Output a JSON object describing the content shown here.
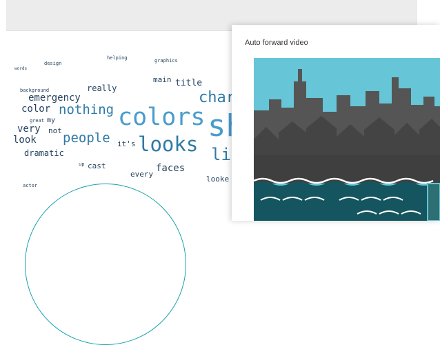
{
  "word_cloud": {
    "words": [
      {
        "text": "helping",
        "cls": "dk"
      },
      {
        "text": "design",
        "cls": "dk"
      },
      {
        "text": "graphics",
        "cls": "dk"
      },
      {
        "text": "words",
        "cls": "dk"
      },
      {
        "text": "main",
        "cls": "dk"
      },
      {
        "text": "title",
        "cls": "dk"
      },
      {
        "text": "really",
        "cls": "dk"
      },
      {
        "text": "background",
        "cls": "dk"
      },
      {
        "text": "emergency",
        "cls": "dk"
      },
      {
        "text": "color",
        "cls": "dk"
      },
      {
        "text": "nothing",
        "cls": "md"
      },
      {
        "text": "colors",
        "cls": "lt"
      },
      {
        "text": "sh",
        "cls": "lt"
      },
      {
        "text": "char",
        "cls": "md"
      },
      {
        "text": "great",
        "cls": "dk"
      },
      {
        "text": "my",
        "cls": "dk"
      },
      {
        "text": "very",
        "cls": "dk"
      },
      {
        "text": "not",
        "cls": "dk"
      },
      {
        "text": "look",
        "cls": "dk"
      },
      {
        "text": "people",
        "cls": "md"
      },
      {
        "text": "it's",
        "cls": "dk"
      },
      {
        "text": "looks",
        "cls": "md"
      },
      {
        "text": "li",
        "cls": "md"
      },
      {
        "text": "dramatic",
        "cls": "dk"
      },
      {
        "text": "up",
        "cls": "dk"
      },
      {
        "text": "cast",
        "cls": "dk"
      },
      {
        "text": "faces",
        "cls": "dk"
      },
      {
        "text": "every",
        "cls": "dk"
      },
      {
        "text": "looke",
        "cls": "dk"
      },
      {
        "text": "actor",
        "cls": "dk"
      }
    ]
  },
  "video_panel": {
    "title": "Auto forward video"
  },
  "colors": {
    "sky": "#66c5d6",
    "buildings": "#4c4c4c",
    "water": "#155560",
    "accent": "#1aa3ad"
  }
}
